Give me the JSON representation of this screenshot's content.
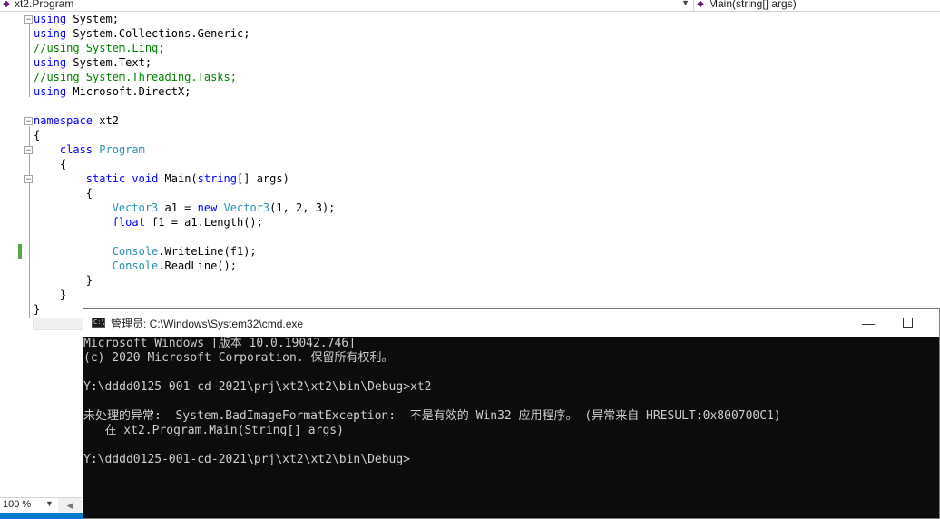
{
  "navbar": {
    "class_selector": "xt2.Program",
    "member_selector": "Main(string[] args)"
  },
  "editor": {
    "code_lines": [
      [
        {
          "t": "using",
          "c": "kw"
        },
        {
          "t": " System;",
          "c": ""
        }
      ],
      [
        {
          "t": "using",
          "c": "kw"
        },
        {
          "t": " System.Collections.Generic;",
          "c": ""
        }
      ],
      [
        {
          "t": "//using System.Linq;",
          "c": "cm"
        }
      ],
      [
        {
          "t": "using",
          "c": "kw"
        },
        {
          "t": " System.Text;",
          "c": ""
        }
      ],
      [
        {
          "t": "//using System.Threading.Tasks;",
          "c": "cm"
        }
      ],
      [
        {
          "t": "using",
          "c": "kw"
        },
        {
          "t": " Microsoft.DirectX;",
          "c": ""
        }
      ],
      [],
      [
        {
          "t": "namespace",
          "c": "kw"
        },
        {
          "t": " xt2",
          "c": ""
        }
      ],
      [
        {
          "t": "{",
          "c": ""
        }
      ],
      [
        {
          "t": "    ",
          "c": ""
        },
        {
          "t": "class",
          "c": "kw"
        },
        {
          "t": " ",
          "c": ""
        },
        {
          "t": "Program",
          "c": "ty"
        }
      ],
      [
        {
          "t": "    {",
          "c": ""
        }
      ],
      [
        {
          "t": "        ",
          "c": ""
        },
        {
          "t": "static",
          "c": "kw"
        },
        {
          "t": " ",
          "c": ""
        },
        {
          "t": "void",
          "c": "kw"
        },
        {
          "t": " Main(",
          "c": ""
        },
        {
          "t": "string",
          "c": "kw"
        },
        {
          "t": "[] args)",
          "c": ""
        }
      ],
      [
        {
          "t": "        {",
          "c": ""
        }
      ],
      [
        {
          "t": "            ",
          "c": ""
        },
        {
          "t": "Vector3",
          "c": "ty"
        },
        {
          "t": " a1 = ",
          "c": ""
        },
        {
          "t": "new",
          "c": "kw"
        },
        {
          "t": " ",
          "c": ""
        },
        {
          "t": "Vector3",
          "c": "ty"
        },
        {
          "t": "(1, 2, 3);",
          "c": ""
        }
      ],
      [
        {
          "t": "            ",
          "c": ""
        },
        {
          "t": "float",
          "c": "kw"
        },
        {
          "t": " f1 = a1.Length();",
          "c": ""
        }
      ],
      [],
      [
        {
          "t": "            ",
          "c": ""
        },
        {
          "t": "Console",
          "c": "ty"
        },
        {
          "t": ".WriteLine(f1);",
          "c": ""
        }
      ],
      [
        {
          "t": "            ",
          "c": ""
        },
        {
          "t": "Console",
          "c": "ty"
        },
        {
          "t": ".ReadLine();",
          "c": ""
        }
      ],
      [
        {
          "t": "        }",
          "c": ""
        }
      ],
      [
        {
          "t": "    }",
          "c": ""
        }
      ],
      [
        {
          "t": "}",
          "c": ""
        }
      ]
    ]
  },
  "status": {
    "zoom": "100 %"
  },
  "console": {
    "title": "管理员: C:\\Windows\\System32\\cmd.exe",
    "icon_text": "C:\\",
    "minimize": "—",
    "lines": [
      "Microsoft Windows [版本 10.0.19042.746]",
      "(c) 2020 Microsoft Corporation. 保留所有权利。",
      "",
      "Y:\\dddd0125-001-cd-2021\\prj\\xt2\\xt2\\bin\\Debug>xt2",
      "",
      "未处理的异常:  System.BadImageFormatException:  不是有效的 Win32 应用程序。 (异常来自 HRESULT:0x800700C1)",
      "   在 xt2.Program.Main(String[] args)",
      "",
      "Y:\\dddd0125-001-cd-2021\\prj\\xt2\\xt2\\bin\\Debug>"
    ]
  }
}
